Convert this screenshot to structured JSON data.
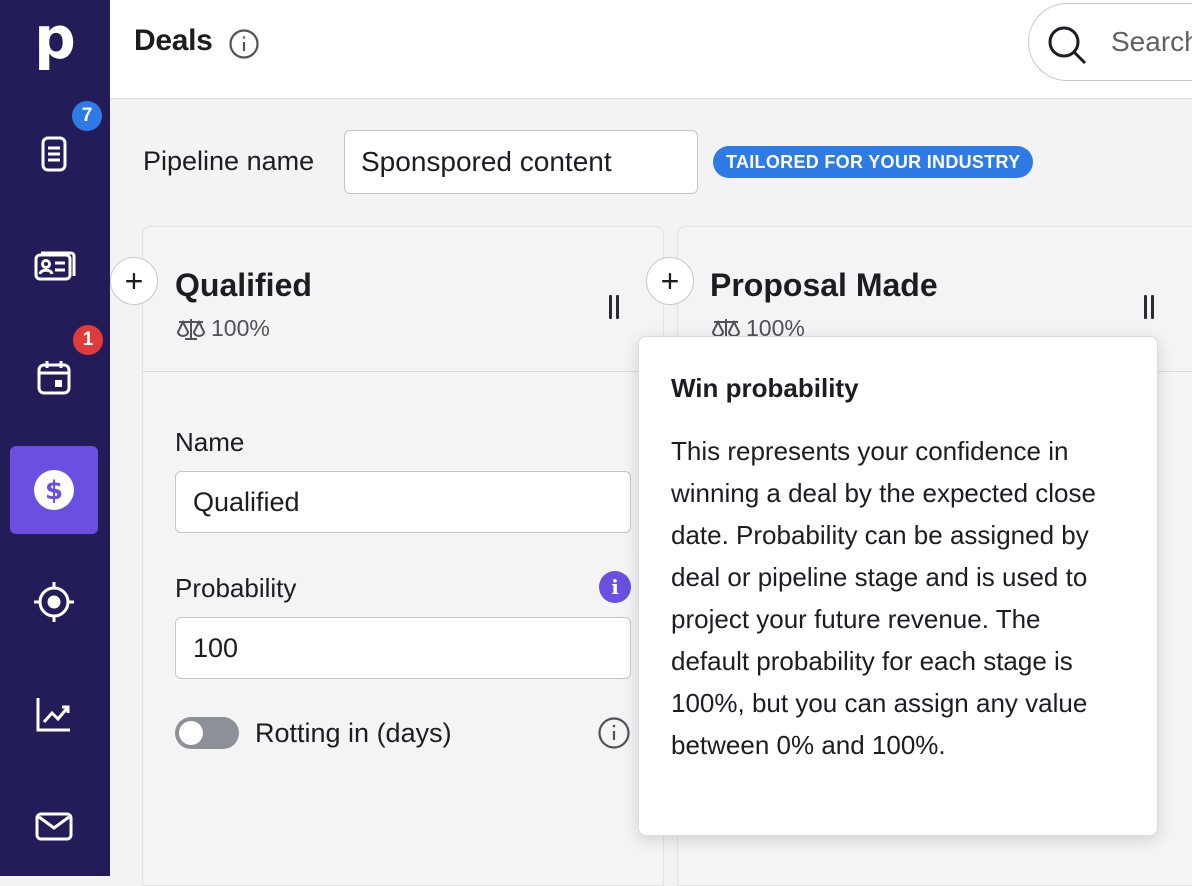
{
  "app": {
    "logo_letter": "p"
  },
  "sidebar": {
    "items": [
      {
        "name": "leads",
        "icon": "leads-inbox-icon",
        "badge": "7",
        "badge_color": "#2f7be6"
      },
      {
        "name": "contacts",
        "icon": "contact-card-icon"
      },
      {
        "name": "activities",
        "icon": "calendar-icon",
        "badge": "1",
        "badge_color": "#df3b3b"
      },
      {
        "name": "deals",
        "icon": "dollar-icon",
        "active": true
      },
      {
        "name": "projects",
        "icon": "target-icon"
      },
      {
        "name": "insights",
        "icon": "chart-line-icon"
      },
      {
        "name": "mail",
        "icon": "mail-icon"
      }
    ],
    "colors": {
      "background": "#221d58",
      "active": "#6a4fe0"
    }
  },
  "header": {
    "title": "Deals",
    "search_placeholder": "Search"
  },
  "pipeline": {
    "label": "Pipeline name",
    "value": "Sponspored content",
    "tag": "TAILORED FOR YOUR INDUSTRY"
  },
  "stages": [
    {
      "title": "Qualified",
      "probability_display": "100%",
      "name_label": "Name",
      "name_value": "Qualified",
      "probability_label": "Probability",
      "probability_value": "100",
      "rotting_label": "Rotting in (days)",
      "rotting_enabled": false
    },
    {
      "title": "Proposal Made",
      "probability_display": "100%"
    }
  ],
  "tooltip": {
    "title": "Win probability",
    "body": "This represents your confidence in winning a deal by the expected close date. Probability can be assigned by deal or pipeline stage and is used to project your future revenue. The default probability for each stage is 100%, but you can assign any value between 0% and 100%."
  }
}
